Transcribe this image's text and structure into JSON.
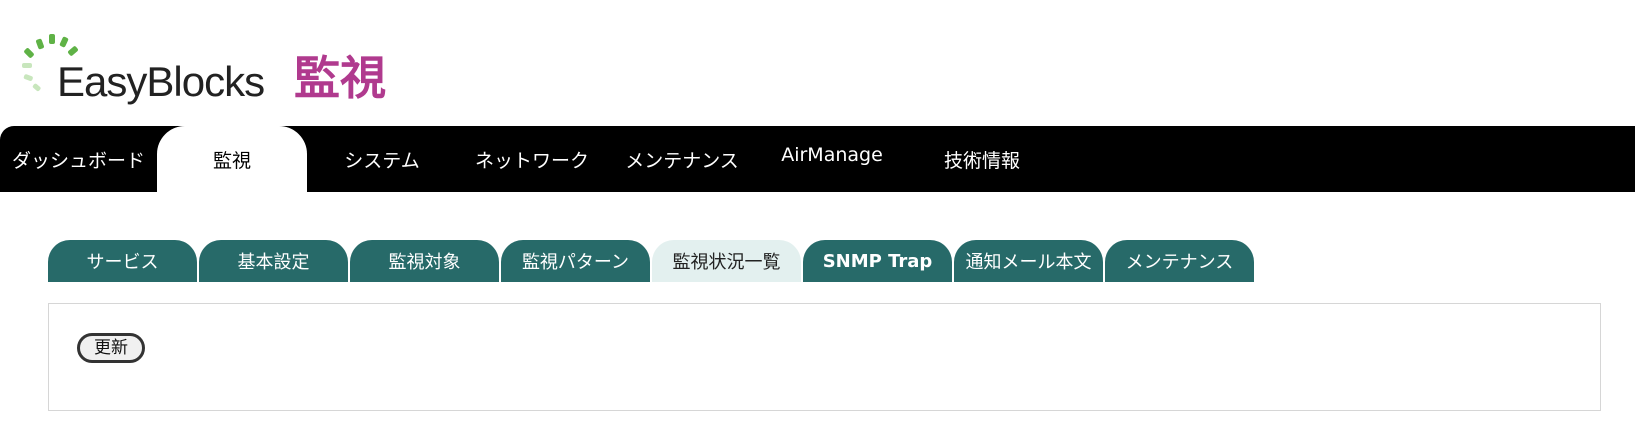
{
  "header": {
    "logo_text": "EasyBlocks",
    "page_title": "監視"
  },
  "colors": {
    "nav_bg": "#000000",
    "tab_bg": "#276a69",
    "tab_active_bg": "#e3f0ef",
    "title_color": "#b03a8e",
    "logo_green": "#5fb246"
  },
  "main_nav": {
    "items": [
      {
        "label": "ダッシュボード"
      },
      {
        "label": "監視",
        "active": true
      },
      {
        "label": "システム"
      },
      {
        "label": "ネットワーク"
      },
      {
        "label": "メンテナンス"
      },
      {
        "label": "AirManage"
      },
      {
        "label": "技術情報"
      }
    ]
  },
  "sub_tabs": {
    "items": [
      {
        "label": "サービス"
      },
      {
        "label": "基本設定"
      },
      {
        "label": "監視対象"
      },
      {
        "label": "監視パターン"
      },
      {
        "label": "監視状況一覧",
        "active": true
      },
      {
        "label": "SNMP Trap"
      },
      {
        "label": "通知メール本文"
      },
      {
        "label": "メンテナンス"
      }
    ]
  },
  "panel": {
    "refresh_button": "更新"
  }
}
